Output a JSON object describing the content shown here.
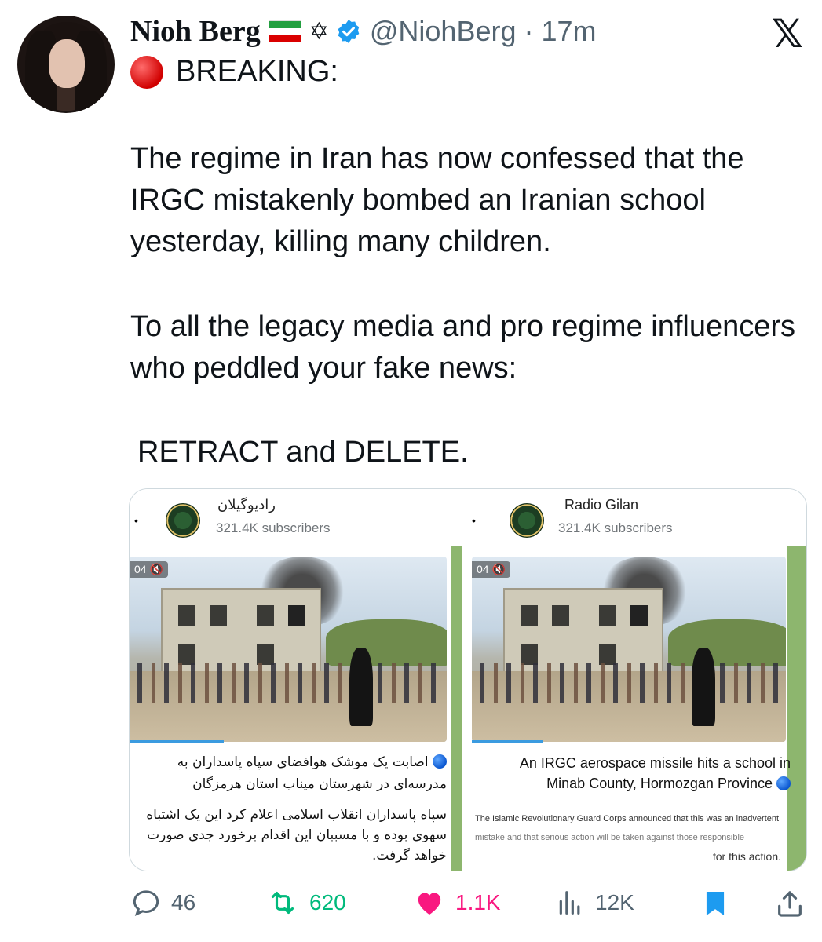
{
  "post": {
    "author_name": "Nioh Berg",
    "badge_symbol": "✡",
    "handle_time": "@NiohBerg · 17m",
    "breaking": "BREAKING:",
    "para1": "The regime in Iran has now confessed that the IRGC mistakenly bombed an Iranian school yesterday, killing many children.",
    "para2": "To all the legacy media and pro regime influencers who peddled your fake news:",
    "para3": "RETRACT and DELETE."
  },
  "media": {
    "left": {
      "channel_name": "راديوگيلان",
      "subscribers": "321.4K subscribers",
      "timestamp": "04",
      "caption1": "اصابت یک موشک هوافضای سپاه پاسداران به مدرسه‌ای در شهرستان میناب استان هرمزگان",
      "caption2": "سپاه پاسداران انقلاب اسلامی اعلام کرد این یک اشتباه سهوی بوده و با مسببان این اقدام برخورد جدی صورت خواهد گرفت."
    },
    "right": {
      "channel_name": "Radio Gilan",
      "subscribers": "321.4K subscribers",
      "timestamp": "04",
      "caption1": "An IRGC aerospace missile hits a school in Minab County, Hormozgan Province",
      "caption2_line1": "The Islamic Revolutionary Guard Corps announced that this was an inadvertent",
      "caption2_line2": "mistake and that serious action will be taken against those responsible",
      "caption2_line3": "for this action."
    }
  },
  "actions": {
    "replies": "46",
    "reposts": "620",
    "likes": "1.1K",
    "views": "12K"
  },
  "colors": {
    "retweet": "#00ba7c",
    "like": "#f91880",
    "verified": "#1d9bf0",
    "muted": "#536471"
  }
}
